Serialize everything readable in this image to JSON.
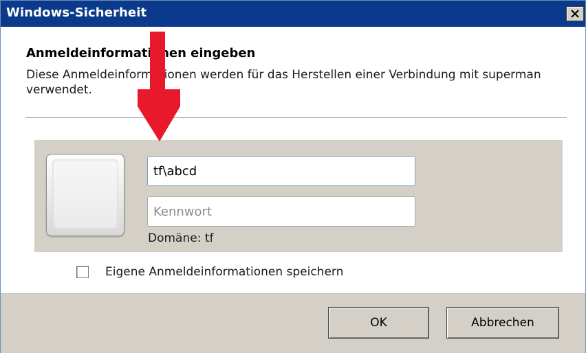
{
  "window": {
    "title": "Windows-Sicherheit",
    "close_label": "close"
  },
  "dialog": {
    "heading": "Anmeldeinformationen eingeben",
    "description": "Diese Anmeldeinformationen werden für das Herstellen einer Verbindung mit superman verwendet."
  },
  "credentials": {
    "username_value": "tf\\abcd",
    "password_placeholder": "Kennwort",
    "domain_text": "Domäne: tf"
  },
  "remember": {
    "label": "Eigene Anmeldeinformationen speichern",
    "checked": false
  },
  "buttons": {
    "ok_label": "OK",
    "cancel_label": "Abbrechen"
  },
  "annotation": {
    "arrow_color": "#e8192c"
  },
  "colors": {
    "titlebar": "#0b3a8c",
    "panel": "#d4d0c8"
  }
}
